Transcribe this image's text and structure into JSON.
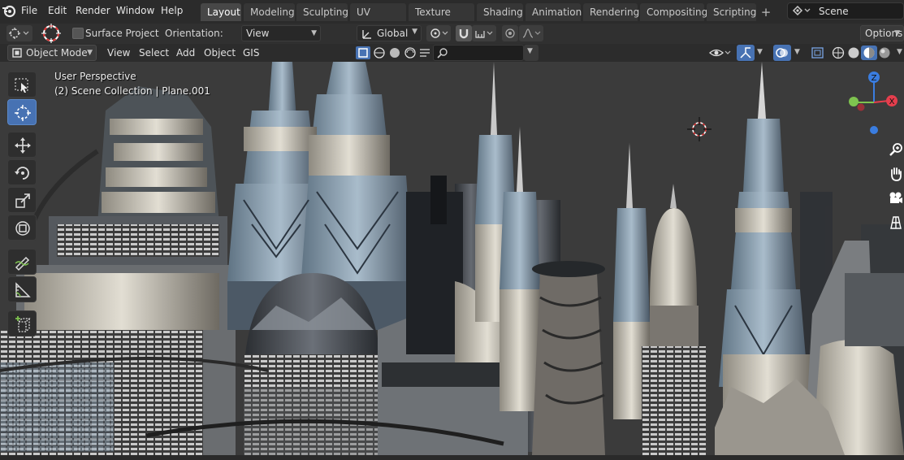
{
  "topbar": {
    "menus": [
      "File",
      "Edit",
      "Render",
      "Window",
      "Help"
    ],
    "workspaces": [
      "Layout",
      "Modeling",
      "Sculpting",
      "UV Editing",
      "Texture Paint",
      "Shading",
      "Animation",
      "Rendering",
      "Compositing",
      "Scripting"
    ],
    "active_workspace": "Layout",
    "scene": "Scene"
  },
  "tool_header": {
    "surface_project": "Surface Project",
    "orientation_label": "Orientation:",
    "orientation_value": "View",
    "transform_orientation": "Global",
    "options": "Options"
  },
  "header": {
    "mode": "Object Mode",
    "menus": [
      "View",
      "Select",
      "Add",
      "Object",
      "GIS"
    ]
  },
  "viewport": {
    "perspective": "User Perspective",
    "collection": "(2) Scene Collection | Plane.001"
  },
  "gizmo": {
    "z": "Z",
    "x": "X",
    "colors": {
      "x": "#e53e4d",
      "y": "#7ec34f",
      "z": "#3a7de0"
    }
  },
  "colors": {
    "accent": "#4772b3",
    "sky": "#3b3b3b"
  }
}
